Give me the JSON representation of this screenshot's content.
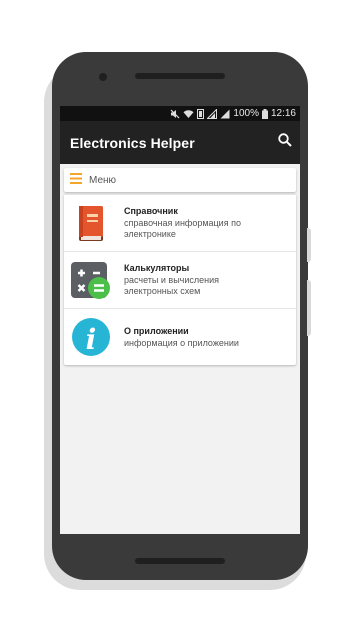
{
  "status_bar": {
    "battery": "100%",
    "time": "12:16"
  },
  "app_bar": {
    "title": "Electronics Helper"
  },
  "menu": {
    "header": "Меню",
    "items": [
      {
        "title": "Справочник",
        "desc": "справочная информация по электронике",
        "icon": "book-icon"
      },
      {
        "title": "Калькуляторы",
        "desc": "расчеты и вычисления электронных схем",
        "icon": "calculator-icon"
      },
      {
        "title": "О приложении",
        "desc": "информация о приложении",
        "icon": "info-icon"
      }
    ]
  },
  "colors": {
    "accent": "#F4A62A",
    "appbar": "#222222",
    "info": "#27B5D6",
    "book": "#E4552E",
    "calc_green": "#4CBF4A"
  }
}
